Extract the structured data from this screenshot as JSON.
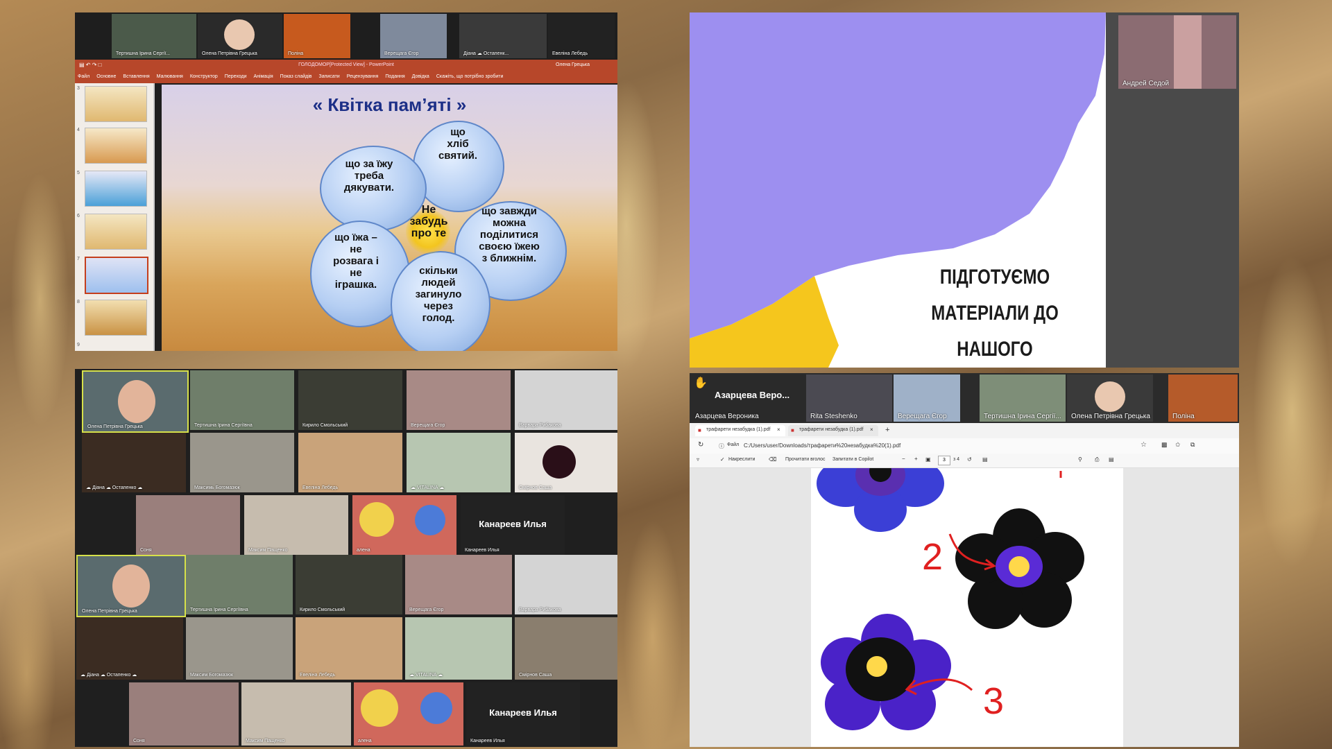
{
  "panelA": {
    "strip": [
      "Тертишна Ірина Сергії...",
      "Олена Петрівна Грецька",
      "Поліна",
      "Верещага Єгор",
      "Діана ☁ Остапенк...",
      "Евеліна Лебедь"
    ],
    "ppt_title": "ГОЛОДОМОР[Protected View] - PowerPoint",
    "ppt_user": "Олена Грецька",
    "tabs": [
      "Файл",
      "Основне",
      "Вставлення",
      "Малювання",
      "Конструктор",
      "Переходи",
      "Анімація",
      "Показ слайдів",
      "Записати",
      "Рецензування",
      "Подання",
      "Довідка",
      "Скажіть, що потрібно зробити"
    ],
    "thumb_nums": [
      "3",
      "4",
      "5",
      "6",
      "7",
      "8",
      "9"
    ],
    "slide_title": "« Квітка  пам’яті »",
    "petals": [
      "що\nхліб\nсвятий.",
      "що за їжу\nтреба\nдякувати.",
      "що завжди\nможна\nподілитися\nсвоєю їжею\nз ближнім.",
      "що їжа –\nне\nрозвага і\nне\nіграшка.",
      "скільки\nлюдей\nзагинуло\nчерез\nголод."
    ],
    "center": "Не\nзабудь\nпро те"
  },
  "panelB": {
    "tiles": [
      "Олена Петрівна Грецька",
      "Тертишна Ірина Сергіївна",
      "Кирило Смольський",
      "Верещага Єгор",
      "Варвара Рибакова",
      "☁ Діана ☁ Остапенко ☁",
      "Максимь Богомазюк",
      "Евеліна Лебедь",
      "☁ VITALINA ☁",
      "Смірнов Саша",
      "Соня",
      "Максим Пащенко",
      "алена",
      "Канареев Илья",
      "Олена Петрівна Грецька",
      "Тертишна Ірина Сергіївна",
      "Кирило Смольський",
      "Верещага Єгор",
      "Варвара Рибакова",
      "☁ Діана ☁ Остапенко ☁",
      "Максим Богомазюк",
      "Евеліна Лебедь",
      "☁ VITALINA ☁",
      "Смірнов Саша",
      "Соня",
      "Максим Пащенко",
      "алена",
      "Канареев Илья"
    ],
    "big_name": "Канареев Илья"
  },
  "panelC": {
    "self_name": "Андрей Седой",
    "text": [
      "ПІДГОТУЄМО",
      "МАТЕРІАЛИ ДО",
      "НАШОГО"
    ]
  },
  "panelD": {
    "strip": [
      "Азарцева Вероника",
      "Rita Steshenko",
      "Верещага Єгор",
      "Тертишна Ірина Сергії...",
      "Олена Петрівна Грецька",
      "Поліна"
    ],
    "big_name": "Азарцева Веро...",
    "tab1": "трафарети незабудка (1).pdf",
    "tab2": "трафарети незабудка (1).pdf",
    "addr_label": "Файл",
    "addr": "C:/Users/user/Downloads/трафарети%20незабудка%20(1).pdf",
    "tool_draw": "Накреслити",
    "tool_read": "Прочитати вголос",
    "tool_ask": "Запитати в Copilot",
    "page": "3",
    "pages": "з 4",
    "marks": [
      "2",
      "3"
    ]
  }
}
